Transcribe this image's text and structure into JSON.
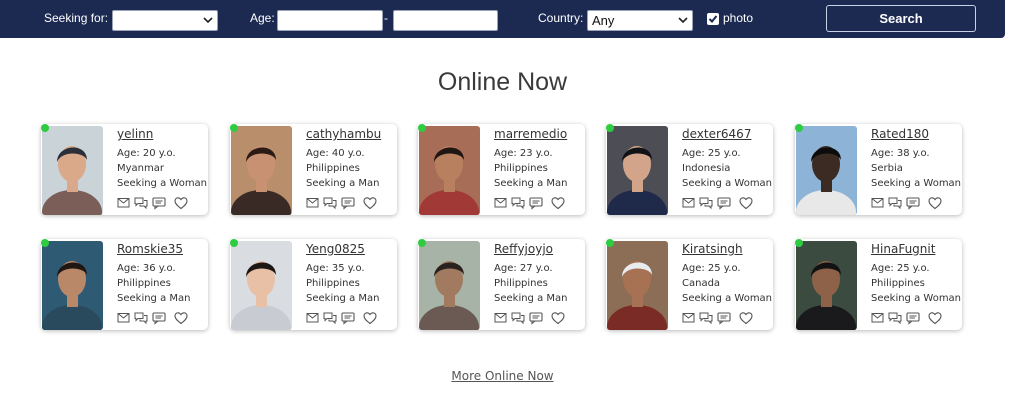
{
  "search": {
    "seeking_label": "Seeking for:",
    "seeking_value": "",
    "age_label": "Age:",
    "age_from": "",
    "age_to": "",
    "age_separator": "-",
    "country_label": "Country:",
    "country_value": "Any",
    "photo_label": "photo",
    "photo_checked": true,
    "search_button": "Search"
  },
  "heading": "Online Now",
  "colors": {
    "navbar": "#1c2a52",
    "online_dot": "#2ecc40"
  },
  "profiles": [
    {
      "username": "yelinn",
      "age": "Age: 20 y.o.",
      "country": "Myanmar",
      "seeking": "Seeking a Woman"
    },
    {
      "username": "cathyhambu",
      "age": "Age: 40 y.o.",
      "country": "Philippines",
      "seeking": "Seeking a Man"
    },
    {
      "username": "marremedio",
      "age": "Age: 23 y.o.",
      "country": "Philippines",
      "seeking": "Seeking a Man"
    },
    {
      "username": "dexter6467",
      "age": "Age: 25 y.o.",
      "country": "Indonesia",
      "seeking": "Seeking a Woman"
    },
    {
      "username": "Rated180",
      "age": "Age: 38 y.o.",
      "country": "Serbia",
      "seeking": "Seeking a Woman"
    },
    {
      "username": "Romskie35",
      "age": "Age: 36 y.o.",
      "country": "Philippines",
      "seeking": "Seeking a Man"
    },
    {
      "username": "Yeng0825",
      "age": "Age: 35 y.o.",
      "country": "Philippines",
      "seeking": "Seeking a Man"
    },
    {
      "username": "Reffyjoyjo",
      "age": "Age: 27 y.o.",
      "country": "Philippines",
      "seeking": "Seeking a Man"
    },
    {
      "username": "Kiratsingh",
      "age": "Age: 25 y.o.",
      "country": "Canada",
      "seeking": "Seeking a Woman"
    },
    {
      "username": "HinaFugnit",
      "age": "Age: 25 y.o.",
      "country": "Philippines",
      "seeking": "Seeking a Woman"
    }
  ],
  "card_actions": [
    "mail-icon",
    "chat-icon",
    "message-icon",
    "heart-icon"
  ],
  "more_link": "More Online Now"
}
